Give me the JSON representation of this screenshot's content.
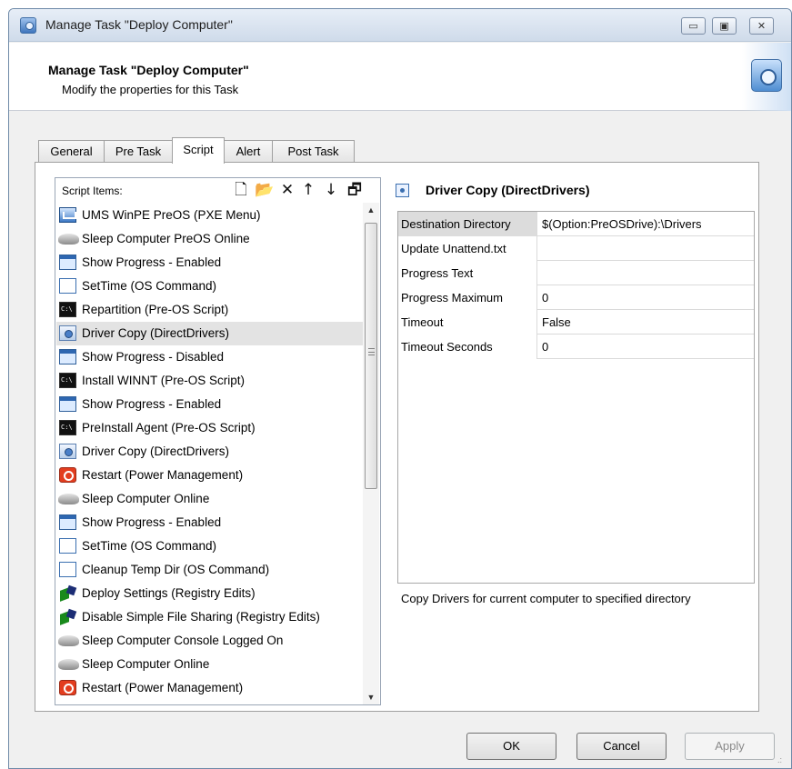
{
  "window": {
    "title": "Manage Task \"Deploy Computer\""
  },
  "header": {
    "title": "Manage Task \"Deploy Computer\"",
    "subtitle": "Modify the properties for this Task"
  },
  "tabs": [
    "General",
    "Pre Task",
    "Script",
    "Alert",
    "Post Task"
  ],
  "active_tab": "Script",
  "script_list": {
    "label": "Script Items:",
    "toolbar": [
      {
        "name": "new-icon",
        "glyph": "🗋"
      },
      {
        "name": "open-folder-icon",
        "glyph": "📂"
      },
      {
        "name": "delete-icon",
        "glyph": "✕"
      },
      {
        "name": "move-up-icon",
        "glyph": "↑"
      },
      {
        "name": "move-down-icon",
        "glyph": "↓"
      },
      {
        "name": "properties-icon",
        "glyph": "🗗"
      }
    ],
    "items": [
      {
        "label": "UMS WinPE PreOS (PXE Menu)",
        "icon": "pxe"
      },
      {
        "label": "Sleep Computer PreOS Online",
        "icon": "sleep"
      },
      {
        "label": "Show Progress - Enabled",
        "icon": "progress"
      },
      {
        "label": "SetTime (OS Command)",
        "icon": "time"
      },
      {
        "label": "Repartition (Pre-OS Script)",
        "icon": "cmd"
      },
      {
        "label": "Driver Copy (DirectDrivers)",
        "icon": "driver",
        "selected": true
      },
      {
        "label": "Show Progress - Disabled",
        "icon": "progress"
      },
      {
        "label": "Install WINNT (Pre-OS Script)",
        "icon": "cmd"
      },
      {
        "label": "Show Progress - Enabled",
        "icon": "progress"
      },
      {
        "label": "PreInstall Agent (Pre-OS Script)",
        "icon": "cmd"
      },
      {
        "label": "Driver Copy (DirectDrivers)",
        "icon": "driver"
      },
      {
        "label": "Restart (Power Management)",
        "icon": "power"
      },
      {
        "label": "Sleep Computer Online",
        "icon": "sleep"
      },
      {
        "label": "Show Progress - Enabled",
        "icon": "progress"
      },
      {
        "label": "SetTime (OS Command)",
        "icon": "time"
      },
      {
        "label": "Cleanup Temp Dir (OS Command)",
        "icon": "time"
      },
      {
        "label": "Deploy Settings (Registry Edits)",
        "icon": "registry"
      },
      {
        "label": "Disable Simple File Sharing (Registry Edits)",
        "icon": "registry"
      },
      {
        "label": "Sleep Computer Console Logged On",
        "icon": "sleep"
      },
      {
        "label": "Sleep Computer Online",
        "icon": "sleep"
      },
      {
        "label": "Restart (Power Management)",
        "icon": "power"
      }
    ]
  },
  "details": {
    "title": "Driver Copy (DirectDrivers)",
    "properties": [
      {
        "key": "Destination Directory",
        "value": "$(Option:PreOSDrive):\\Drivers",
        "selected": true
      },
      {
        "key": "Update Unattend.txt",
        "value": ""
      },
      {
        "key": "Progress Text",
        "value": ""
      },
      {
        "key": "Progress Maximum",
        "value": "0"
      },
      {
        "key": "Timeout",
        "value": "False"
      },
      {
        "key": "Timeout Seconds",
        "value": "0"
      }
    ],
    "description": "Copy Drivers for current computer to specified directory"
  },
  "buttons": {
    "ok": "OK",
    "cancel": "Cancel",
    "apply": "Apply"
  }
}
